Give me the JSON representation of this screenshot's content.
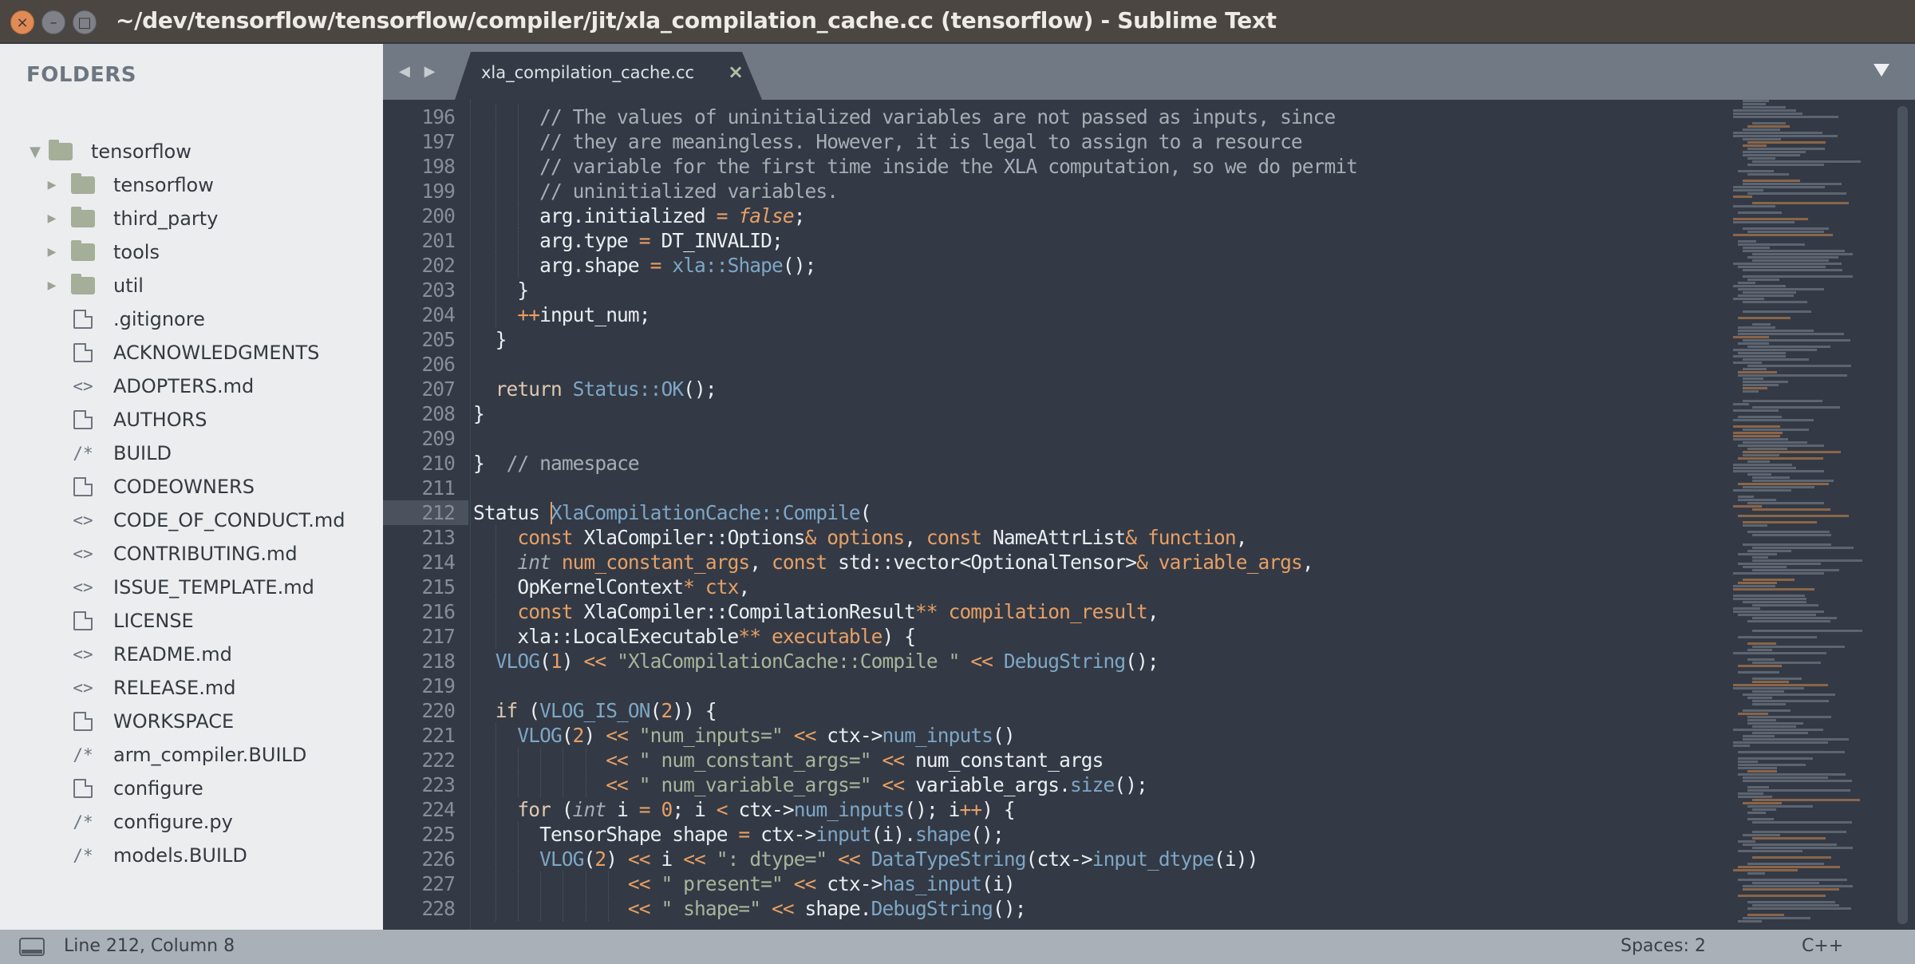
{
  "window": {
    "title": "~/dev/tensorflow/tensorflow/compiler/jit/xla_compilation_cache.cc (tensorflow) - Sublime Text",
    "controls": {
      "close": "×",
      "minimize": "–",
      "maximize": "□"
    }
  },
  "sidebar": {
    "title": "FOLDERS",
    "root": {
      "label": "tensorflow",
      "icon": "folder-open-icon",
      "expanded": true
    },
    "items": [
      {
        "label": "tensorflow",
        "type": "folder",
        "icon": "folder-icon"
      },
      {
        "label": "third_party",
        "type": "folder",
        "icon": "folder-icon"
      },
      {
        "label": "tools",
        "type": "folder",
        "icon": "folder-icon"
      },
      {
        "label": "util",
        "type": "folder",
        "icon": "folder-icon"
      },
      {
        "label": ".gitignore",
        "type": "file",
        "icon": "file-icon"
      },
      {
        "label": "ACKNOWLEDGMENTS",
        "type": "file",
        "icon": "file-icon"
      },
      {
        "label": "ADOPTERS.md",
        "type": "markup",
        "icon": "markup-icon"
      },
      {
        "label": "AUTHORS",
        "type": "file",
        "icon": "file-icon"
      },
      {
        "label": "BUILD",
        "type": "source",
        "icon": "source-icon"
      },
      {
        "label": "CODEOWNERS",
        "type": "file",
        "icon": "file-icon"
      },
      {
        "label": "CODE_OF_CONDUCT.md",
        "type": "markup",
        "icon": "markup-icon"
      },
      {
        "label": "CONTRIBUTING.md",
        "type": "markup",
        "icon": "markup-icon"
      },
      {
        "label": "ISSUE_TEMPLATE.md",
        "type": "markup",
        "icon": "markup-icon"
      },
      {
        "label": "LICENSE",
        "type": "file",
        "icon": "file-icon"
      },
      {
        "label": "README.md",
        "type": "markup",
        "icon": "markup-icon"
      },
      {
        "label": "RELEASE.md",
        "type": "markup",
        "icon": "markup-icon"
      },
      {
        "label": "WORKSPACE",
        "type": "file",
        "icon": "file-icon"
      },
      {
        "label": "arm_compiler.BUILD",
        "type": "source",
        "icon": "source-icon"
      },
      {
        "label": "configure",
        "type": "file",
        "icon": "file-icon"
      },
      {
        "label": "configure.py",
        "type": "source",
        "icon": "source-icon"
      },
      {
        "label": "models.BUILD",
        "type": "source",
        "icon": "source-icon"
      }
    ],
    "glyphs": {
      "markup": "<>",
      "source": "/*",
      "collapsed": "▶",
      "expanded": "▼"
    }
  },
  "tabs": {
    "nav_glyph": "◀ ▶",
    "items": [
      {
        "label": "xla_compilation_cache.cc",
        "active": true,
        "close": "×"
      }
    ],
    "dropdown": "▼"
  },
  "editor": {
    "current_line": 212,
    "lines": [
      {
        "n": 196,
        "indent": 3,
        "tokens": [
          [
            "c",
            "// The values of uninitialized variables are not passed as inputs, since"
          ]
        ]
      },
      {
        "n": 197,
        "indent": 3,
        "tokens": [
          [
            "c",
            "// they are meaningless. However, it is legal to assign to a resource"
          ]
        ]
      },
      {
        "n": 198,
        "indent": 3,
        "tokens": [
          [
            "c",
            "// variable for the first time inside the XLA computation, so we do permit"
          ]
        ]
      },
      {
        "n": 199,
        "indent": 3,
        "tokens": [
          [
            "c",
            "// uninitialized variables."
          ]
        ]
      },
      {
        "n": 200,
        "indent": 3,
        "tokens": [
          [
            "p",
            "arg.initialized "
          ],
          [
            "o",
            "="
          ],
          [
            "p",
            " "
          ],
          [
            "i",
            "false"
          ],
          [
            "p",
            ";"
          ]
        ]
      },
      {
        "n": 201,
        "indent": 3,
        "tokens": [
          [
            "p",
            "arg.type "
          ],
          [
            "o",
            "="
          ],
          [
            "p",
            " DT_INVALID;"
          ]
        ]
      },
      {
        "n": 202,
        "indent": 3,
        "tokens": [
          [
            "p",
            "arg.shape "
          ],
          [
            "o",
            "="
          ],
          [
            "p",
            " "
          ],
          [
            "f",
            "xla::Shape"
          ],
          [
            "p",
            "();"
          ]
        ]
      },
      {
        "n": 203,
        "indent": 2,
        "tokens": [
          [
            "p",
            "}"
          ]
        ]
      },
      {
        "n": 204,
        "indent": 2,
        "tokens": [
          [
            "o",
            "++"
          ],
          [
            "p",
            "input_num;"
          ]
        ]
      },
      {
        "n": 205,
        "indent": 1,
        "tokens": [
          [
            "p",
            "}"
          ]
        ]
      },
      {
        "n": 206,
        "indent": 0,
        "tokens": []
      },
      {
        "n": 207,
        "indent": 1,
        "tokens": [
          [
            "r",
            "return"
          ],
          [
            "p",
            " "
          ],
          [
            "f",
            "Status::OK"
          ],
          [
            "p",
            "();"
          ]
        ]
      },
      {
        "n": 208,
        "indent": 0,
        "tokens": [
          [
            "p",
            "}"
          ]
        ]
      },
      {
        "n": 209,
        "indent": 0,
        "tokens": []
      },
      {
        "n": 210,
        "indent": 0,
        "tokens": [
          [
            "p",
            "}  "
          ],
          [
            "c",
            "// namespace"
          ]
        ]
      },
      {
        "n": 211,
        "indent": 0,
        "tokens": []
      },
      {
        "n": 212,
        "indent": 0,
        "caret_after": 7,
        "tokens": [
          [
            "p",
            "Status "
          ],
          [
            "f",
            "XlaCompilationCache::Compile"
          ],
          [
            "p",
            "("
          ]
        ]
      },
      {
        "n": 213,
        "indent": 2,
        "tokens": [
          [
            "k",
            "const"
          ],
          [
            "p",
            " XlaCompiler::Options"
          ],
          [
            "o",
            "&"
          ],
          [
            "p",
            " "
          ],
          [
            "n",
            "options"
          ],
          [
            "p",
            ", "
          ],
          [
            "k",
            "const"
          ],
          [
            "p",
            " NameAttrList"
          ],
          [
            "o",
            "&"
          ],
          [
            "p",
            " "
          ],
          [
            "n",
            "function"
          ],
          [
            "p",
            ","
          ]
        ]
      },
      {
        "n": 214,
        "indent": 2,
        "tokens": [
          [
            "t",
            "int"
          ],
          [
            "p",
            " "
          ],
          [
            "n",
            "num_constant_args"
          ],
          [
            "p",
            ", "
          ],
          [
            "k",
            "const"
          ],
          [
            "p",
            " std::vector<OptionalTensor>"
          ],
          [
            "o",
            "&"
          ],
          [
            "p",
            " "
          ],
          [
            "n",
            "variable_args"
          ],
          [
            "p",
            ","
          ]
        ]
      },
      {
        "n": 215,
        "indent": 2,
        "tokens": [
          [
            "p",
            "OpKernelContext"
          ],
          [
            "o",
            "*"
          ],
          [
            "p",
            " "
          ],
          [
            "n",
            "ctx"
          ],
          [
            "p",
            ","
          ]
        ]
      },
      {
        "n": 216,
        "indent": 2,
        "tokens": [
          [
            "k",
            "const"
          ],
          [
            "p",
            " XlaCompiler::CompilationResult"
          ],
          [
            "o",
            "**"
          ],
          [
            "p",
            " "
          ],
          [
            "n",
            "compilation_result"
          ],
          [
            "p",
            ","
          ]
        ]
      },
      {
        "n": 217,
        "indent": 2,
        "tokens": [
          [
            "p",
            "xla::LocalExecutable"
          ],
          [
            "o",
            "**"
          ],
          [
            "p",
            " "
          ],
          [
            "n",
            "executable"
          ],
          [
            "p",
            ") {"
          ]
        ]
      },
      {
        "n": 218,
        "indent": 1,
        "tokens": [
          [
            "f",
            "VLOG"
          ],
          [
            "p",
            "("
          ],
          [
            "n",
            "1"
          ],
          [
            "p",
            ") "
          ],
          [
            "o",
            "<<"
          ],
          [
            "p",
            " "
          ],
          [
            "s",
            "\"XlaCompilationCache::Compile \""
          ],
          [
            "p",
            " "
          ],
          [
            "o",
            "<<"
          ],
          [
            "p",
            " "
          ],
          [
            "f",
            "DebugString"
          ],
          [
            "p",
            "();"
          ]
        ]
      },
      {
        "n": 219,
        "indent": 0,
        "tokens": []
      },
      {
        "n": 220,
        "indent": 1,
        "tokens": [
          [
            "r",
            "if"
          ],
          [
            "p",
            " ("
          ],
          [
            "f",
            "VLOG_IS_ON"
          ],
          [
            "p",
            "("
          ],
          [
            "n",
            "2"
          ],
          [
            "p",
            ")) {"
          ]
        ]
      },
      {
        "n": 221,
        "indent": 2,
        "tokens": [
          [
            "f",
            "VLOG"
          ],
          [
            "p",
            "("
          ],
          [
            "n",
            "2"
          ],
          [
            "p",
            ") "
          ],
          [
            "o",
            "<<"
          ],
          [
            "p",
            " "
          ],
          [
            "s",
            "\"num_inputs=\""
          ],
          [
            "p",
            " "
          ],
          [
            "o",
            "<<"
          ],
          [
            "p",
            " ctx->"
          ],
          [
            "f",
            "num_inputs"
          ],
          [
            "p",
            "()"
          ]
        ]
      },
      {
        "n": 222,
        "indent": 2,
        "pad": "        ",
        "tokens": [
          [
            "o",
            "<<"
          ],
          [
            "p",
            " "
          ],
          [
            "s",
            "\" num_constant_args=\""
          ],
          [
            "p",
            " "
          ],
          [
            "o",
            "<<"
          ],
          [
            "p",
            " num_constant_args"
          ]
        ]
      },
      {
        "n": 223,
        "indent": 2,
        "pad": "        ",
        "tokens": [
          [
            "o",
            "<<"
          ],
          [
            "p",
            " "
          ],
          [
            "s",
            "\" num_variable_args=\""
          ],
          [
            "p",
            " "
          ],
          [
            "o",
            "<<"
          ],
          [
            "p",
            " variable_args."
          ],
          [
            "f",
            "size"
          ],
          [
            "p",
            "();"
          ]
        ]
      },
      {
        "n": 224,
        "indent": 2,
        "tokens": [
          [
            "r",
            "for"
          ],
          [
            "p",
            " ("
          ],
          [
            "t",
            "int"
          ],
          [
            "p",
            " i "
          ],
          [
            "o",
            "="
          ],
          [
            "p",
            " "
          ],
          [
            "n",
            "0"
          ],
          [
            "p",
            "; i "
          ],
          [
            "o",
            "<"
          ],
          [
            "p",
            " ctx->"
          ],
          [
            "f",
            "num_inputs"
          ],
          [
            "p",
            "(); i"
          ],
          [
            "o",
            "++"
          ],
          [
            "p",
            ") {"
          ]
        ]
      },
      {
        "n": 225,
        "indent": 3,
        "tokens": [
          [
            "p",
            "TensorShape shape "
          ],
          [
            "o",
            "="
          ],
          [
            "p",
            " ctx->"
          ],
          [
            "f",
            "input"
          ],
          [
            "p",
            "(i)."
          ],
          [
            "f",
            "shape"
          ],
          [
            "p",
            "();"
          ]
        ]
      },
      {
        "n": 226,
        "indent": 3,
        "tokens": [
          [
            "f",
            "VLOG"
          ],
          [
            "p",
            "("
          ],
          [
            "n",
            "2"
          ],
          [
            "p",
            ") "
          ],
          [
            "o",
            "<<"
          ],
          [
            "p",
            " i "
          ],
          [
            "o",
            "<<"
          ],
          [
            "p",
            " "
          ],
          [
            "s",
            "\": dtype=\""
          ],
          [
            "p",
            " "
          ],
          [
            "o",
            "<<"
          ],
          [
            "p",
            " "
          ],
          [
            "f",
            "DataTypeString"
          ],
          [
            "p",
            "(ctx->"
          ],
          [
            "f",
            "input_dtype"
          ],
          [
            "p",
            "(i))"
          ]
        ]
      },
      {
        "n": 227,
        "indent": 3,
        "pad": "        ",
        "tokens": [
          [
            "o",
            "<<"
          ],
          [
            "p",
            " "
          ],
          [
            "s",
            "\" present=\""
          ],
          [
            "p",
            " "
          ],
          [
            "o",
            "<<"
          ],
          [
            "p",
            " ctx->"
          ],
          [
            "f",
            "has_input"
          ],
          [
            "p",
            "(i)"
          ]
        ]
      },
      {
        "n": 228,
        "indent": 3,
        "pad": "        ",
        "tokens": [
          [
            "o",
            "<<"
          ],
          [
            "p",
            " "
          ],
          [
            "s",
            "\" shape=\""
          ],
          [
            "p",
            " "
          ],
          [
            "o",
            "<<"
          ],
          [
            "p",
            " shape."
          ],
          [
            "f",
            "DebugString"
          ],
          [
            "p",
            "();"
          ]
        ]
      }
    ]
  },
  "statusbar": {
    "position": "Line 212, Column 8",
    "indentation": "Spaces: 2",
    "syntax": "C++"
  }
}
